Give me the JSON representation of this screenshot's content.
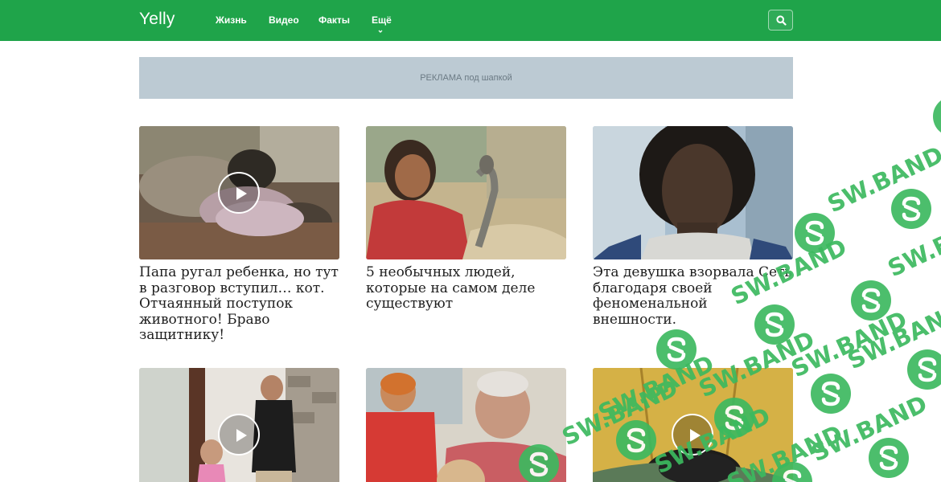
{
  "header": {
    "logo": "Yelly",
    "nav": [
      "Жизнь",
      "Видео",
      "Факты",
      "Ещё"
    ]
  },
  "ad": {
    "label": "РЕКЛАМА под шапкой"
  },
  "cards": [
    {
      "title": "Папа ругал ребенка, но тут в разговор вступил… кот. Отчаянный поступок животного! Браво защитнику!",
      "has_video": true
    },
    {
      "title": "5 необычных людей, которые на самом деле существуют",
      "has_video": false
    },
    {
      "title": "Эта девушка взорвала Сеть благодаря своей феноменальной внешности.",
      "has_video": false
    },
    {
      "title": "",
      "has_video": true
    },
    {
      "title": "",
      "has_video": false
    },
    {
      "title": "",
      "has_video": true
    }
  ],
  "watermark": {
    "text": "SW.BAND",
    "color": "#3cb95f"
  },
  "colors": {
    "header_bg": "#1fa44a",
    "ad_bg": "#bccad3"
  },
  "icons": [
    "search-icon",
    "chevron-down-icon",
    "play-icon"
  ]
}
